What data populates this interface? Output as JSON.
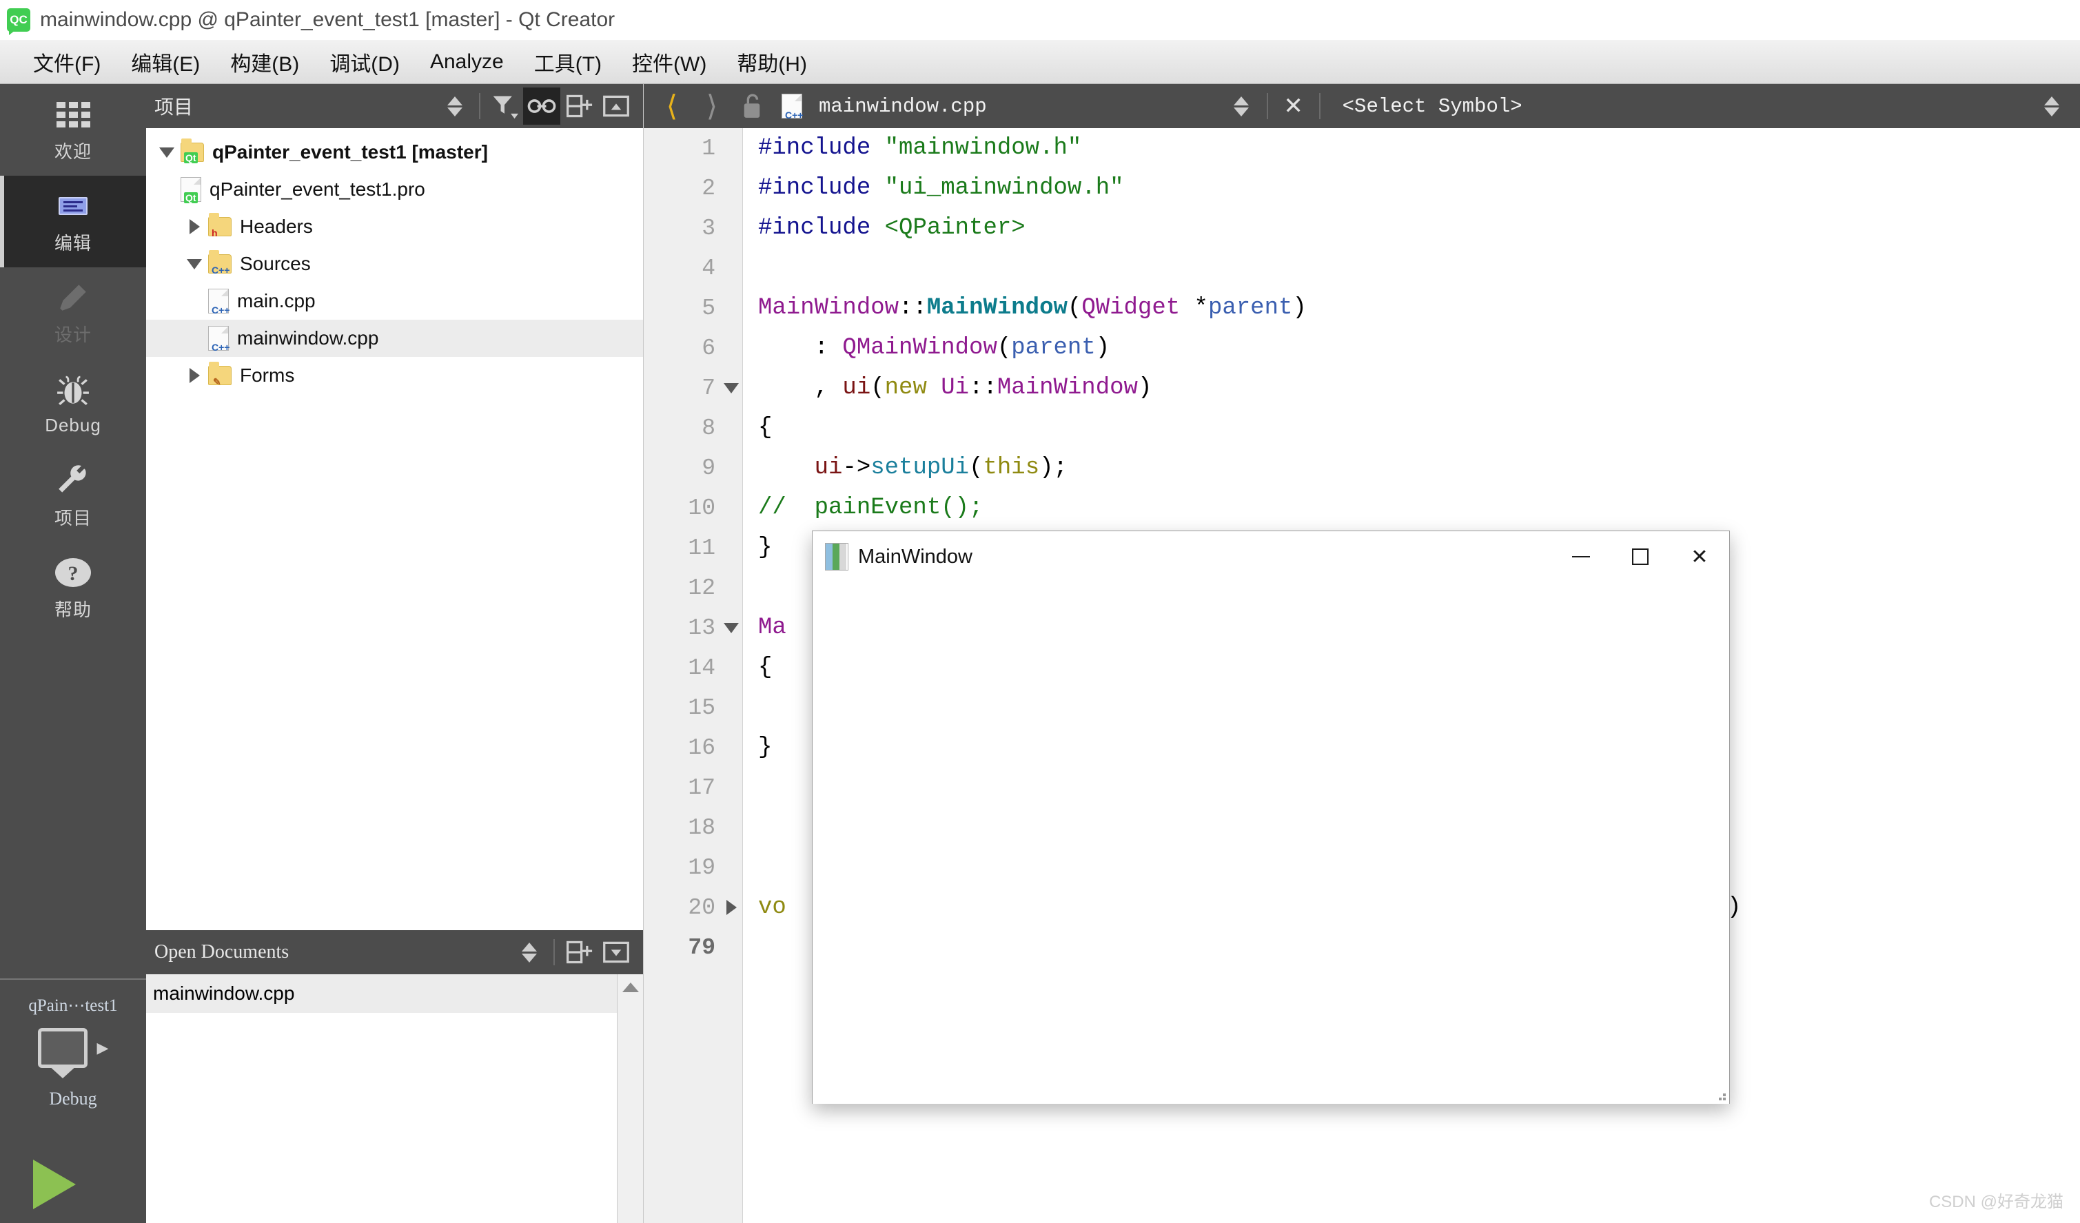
{
  "window": {
    "title": "mainwindow.cpp @ qPainter_event_test1 [master] - Qt Creator",
    "logo": "qt-creator-logo"
  },
  "menubar": {
    "items": [
      {
        "label": "文件(F)",
        "mnemonic": "F"
      },
      {
        "label": "编辑(E)",
        "mnemonic": "E"
      },
      {
        "label": "构建(B)",
        "mnemonic": "B"
      },
      {
        "label": "调试(D)",
        "mnemonic": "D"
      },
      {
        "label": "Analyze",
        "mnemonic": "A"
      },
      {
        "label": "工具(T)",
        "mnemonic": "T"
      },
      {
        "label": "控件(W)",
        "mnemonic": "W"
      },
      {
        "label": "帮助(H)",
        "mnemonic": "H"
      }
    ]
  },
  "modebar": {
    "items": [
      {
        "label": "欢迎",
        "icon": "grid-icon",
        "state": "normal"
      },
      {
        "label": "编辑",
        "icon": "edit-document-icon",
        "state": "selected"
      },
      {
        "label": "设计",
        "icon": "pencil-icon",
        "state": "disabled"
      },
      {
        "label": "Debug",
        "icon": "bug-icon",
        "state": "normal"
      },
      {
        "label": "项目",
        "icon": "wrench-icon",
        "state": "normal"
      },
      {
        "label": "帮助",
        "icon": "question-mark-icon",
        "state": "normal"
      }
    ]
  },
  "kit_selector": {
    "project": "qPain⋯test1",
    "icon": "monitor-icon",
    "build_config": "Debug",
    "run_button": "run-icon"
  },
  "project_panel": {
    "title": "项目",
    "toolbar": [
      {
        "name": "updown-arrows-icon",
        "active": false
      },
      {
        "name": "filter-icon",
        "active": false
      },
      {
        "name": "link-icon",
        "active": true
      },
      {
        "name": "split-add-icon",
        "active": false
      },
      {
        "name": "collapse-panel-icon",
        "active": false
      }
    ],
    "tree": [
      {
        "label": "qPainter_event_test1 [master]",
        "indent": 0,
        "twisty": "down",
        "icon": "qt-folder-icon",
        "bold": true,
        "selected": false
      },
      {
        "label": "qPainter_event_test1.pro",
        "indent": 1,
        "twisty": "none",
        "icon": "qt-file-icon",
        "bold": false,
        "selected": false
      },
      {
        "label": "Headers",
        "indent": 1,
        "twisty": "right",
        "icon": "h-folder-icon",
        "bold": false,
        "selected": false
      },
      {
        "label": "Sources",
        "indent": 1,
        "twisty": "down",
        "icon": "cpp-folder-icon",
        "bold": false,
        "selected": false
      },
      {
        "label": "main.cpp",
        "indent": 2,
        "twisty": "none",
        "icon": "cpp-file-icon",
        "bold": false,
        "selected": false
      },
      {
        "label": "mainwindow.cpp",
        "indent": 2,
        "twisty": "none",
        "icon": "cpp-file-icon",
        "bold": false,
        "selected": true
      },
      {
        "label": "Forms",
        "indent": 1,
        "twisty": "right",
        "icon": "forms-folder-icon",
        "bold": false,
        "selected": false
      }
    ]
  },
  "open_documents": {
    "title": "Open Documents",
    "toolbar": [
      {
        "name": "updown-arrows-icon"
      },
      {
        "name": "split-add-icon"
      },
      {
        "name": "collapse-panel-icon"
      }
    ],
    "items": [
      {
        "label": "mainwindow.cpp",
        "selected": true
      }
    ]
  },
  "editor_toolbar": {
    "back": "back-arrow-icon",
    "forward": "forward-arrow-icon",
    "lock": "unlocked-icon",
    "file_icon": "cpp-file-icon",
    "file_name": "mainwindow.cpp",
    "updown": "updown-arrows-icon",
    "close": "close-icon",
    "symbol_selector": "<Select Symbol>",
    "right_updown": "updown-arrows-icon"
  },
  "code": {
    "total_lines": "79",
    "lines": [
      {
        "n": "1",
        "fold": "none",
        "tokens": [
          {
            "t": "#include ",
            "c": "pre"
          },
          {
            "t": "\"mainwindow.h\"",
            "c": "str"
          }
        ]
      },
      {
        "n": "2",
        "fold": "none",
        "tokens": [
          {
            "t": "#include ",
            "c": "pre"
          },
          {
            "t": "\"ui_mainwindow.h\"",
            "c": "str"
          }
        ]
      },
      {
        "n": "3",
        "fold": "none",
        "tokens": [
          {
            "t": "#include ",
            "c": "pre"
          },
          {
            "t": "<QPainter>",
            "c": "str"
          }
        ]
      },
      {
        "n": "4",
        "fold": "none",
        "tokens": []
      },
      {
        "n": "5",
        "fold": "none",
        "tokens": [
          {
            "t": "MainWindow",
            "c": "cls"
          },
          {
            "t": "::",
            "c": "pun"
          },
          {
            "t": "MainWindow",
            "c": "fn"
          },
          {
            "t": "(",
            "c": "pun"
          },
          {
            "t": "QWidget",
            "c": "cls"
          },
          {
            "t": " *",
            "c": "pun"
          },
          {
            "t": "parent",
            "c": "var"
          },
          {
            "t": ")",
            "c": "pun"
          }
        ]
      },
      {
        "n": "6",
        "fold": "none",
        "tokens": [
          {
            "t": "    : ",
            "c": "pun"
          },
          {
            "t": "QMainWindow",
            "c": "cls"
          },
          {
            "t": "(",
            "c": "pun"
          },
          {
            "t": "parent",
            "c": "var"
          },
          {
            "t": ")",
            "c": "pun"
          }
        ]
      },
      {
        "n": "7",
        "fold": "down",
        "tokens": [
          {
            "t": "    , ",
            "c": "pun"
          },
          {
            "t": "ui",
            "c": "mem"
          },
          {
            "t": "(",
            "c": "pun"
          },
          {
            "t": "new",
            "c": "kw"
          },
          {
            "t": " ",
            "c": "pun"
          },
          {
            "t": "Ui",
            "c": "cls"
          },
          {
            "t": "::",
            "c": "pun"
          },
          {
            "t": "MainWindow",
            "c": "cls"
          },
          {
            "t": ")",
            "c": "pun"
          }
        ]
      },
      {
        "n": "8",
        "fold": "none",
        "tokens": [
          {
            "t": "{",
            "c": "pun"
          }
        ]
      },
      {
        "n": "9",
        "fold": "none",
        "tokens": [
          {
            "t": "    ",
            "c": "pun"
          },
          {
            "t": "ui",
            "c": "mem"
          },
          {
            "t": "->",
            "c": "pun"
          },
          {
            "t": "setupUi",
            "c": "fn2"
          },
          {
            "t": "(",
            "c": "pun"
          },
          {
            "t": "this",
            "c": "kw"
          },
          {
            "t": ");",
            "c": "pun"
          }
        ]
      },
      {
        "n": "10",
        "fold": "none",
        "tokens": [
          {
            "t": "//  painEvent();",
            "c": "cmt"
          }
        ]
      },
      {
        "n": "11",
        "fold": "none",
        "tokens": [
          {
            "t": "}",
            "c": "pun"
          }
        ]
      },
      {
        "n": "12",
        "fold": "none",
        "tokens": []
      },
      {
        "n": "13",
        "fold": "down",
        "tokens": [
          {
            "t": "Ma",
            "c": "cls"
          }
        ]
      },
      {
        "n": "14",
        "fold": "none",
        "tokens": [
          {
            "t": "{",
            "c": "pun"
          }
        ]
      },
      {
        "n": "15",
        "fold": "none",
        "tokens": []
      },
      {
        "n": "16",
        "fold": "none",
        "tokens": [
          {
            "t": "}",
            "c": "pun"
          }
        ]
      },
      {
        "n": "17",
        "fold": "none",
        "tokens": []
      },
      {
        "n": "18",
        "fold": "none",
        "tokens": []
      },
      {
        "n": "19",
        "fold": "none",
        "tokens": []
      },
      {
        "n": "20",
        "fold": "right",
        "tokens": [
          {
            "t": "vo",
            "c": "kw"
          }
        ]
      }
    ]
  },
  "mainwindow_dialog": {
    "title": "MainWindow",
    "icon": "app-window-icon",
    "minimize": "minimize-icon",
    "maximize": "maximize-icon",
    "close": "close-icon",
    "resize_grip": "resize-grip-icon"
  },
  "watermark": "CSDN @好奇龙猫",
  "colors": {
    "accent_green": "#41cd52",
    "mode_selected_bg": "#2a2a2a",
    "panel_header_bg": "#4c4c4c",
    "selection_bg": "#ececec",
    "run_green": "#8cc152",
    "back_arrow": "#e8b21a"
  }
}
